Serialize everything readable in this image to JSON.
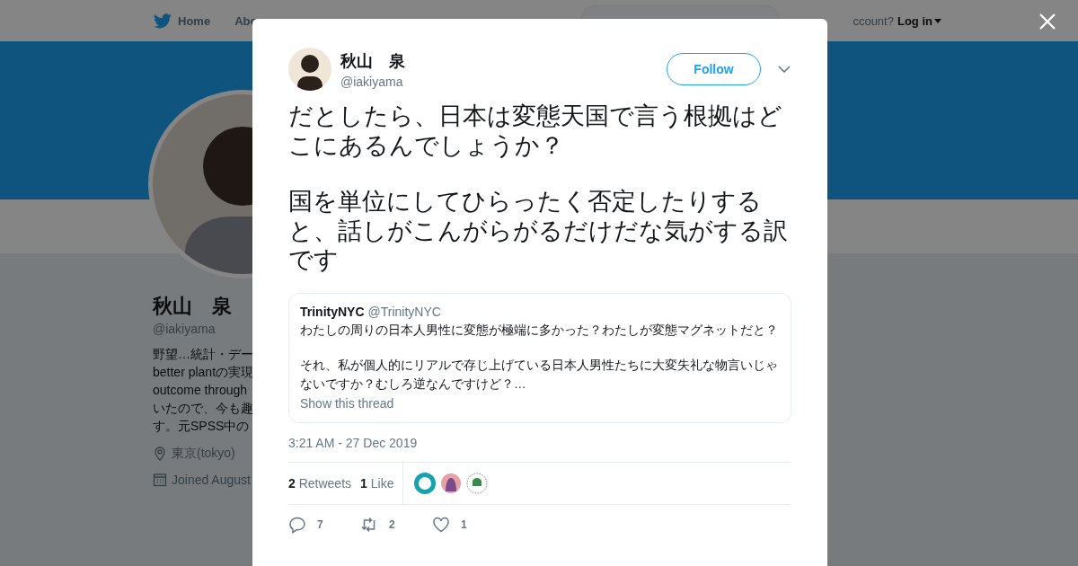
{
  "topbar": {
    "home": "Home",
    "about": "Abo",
    "account": "ccount?",
    "login": "Log in"
  },
  "profile": {
    "name": "秋山　泉",
    "handle": "@iakiyama",
    "bio_lines": [
      "野望…統計・デー",
      "better plantの実現",
      "outcome through",
      "いたので、今も趣",
      "す。元SPSS中の"
    ],
    "location": "東京(tokyo)",
    "joined": "Joined August"
  },
  "tweet": {
    "author": "秋山　泉",
    "handle": "@iakiyama",
    "follow": "Follow",
    "paragraphs": [
      "だとしたら、日本は変態天国で言う根拠はどこにあるんでしょうか？",
      "国を単位にしてひらったく否定したりすると、話しがこんがらがるだけだな気がする訳です"
    ],
    "quote": {
      "author": "TrinityNYC",
      "handle": "@TrinityNYC",
      "paragraphs": [
        "わたしの周りの日本人男性に変態が極端に多かった？わたしが変態マグネットだと？",
        "それ、私が個人的にリアルで存じ上げている日本人男性たちに大変失礼な物言いじゃないですか？むしろ逆なんですけど？…"
      ],
      "link": "Show this thread"
    },
    "timestamp": "3:21 AM - 27 Dec 2019",
    "stats": [
      {
        "count": "2",
        "label": "Retweets"
      },
      {
        "count": "1",
        "label": "Like"
      }
    ],
    "likers": [
      {
        "color": "#17a2b0"
      },
      {
        "color": "#e8a0a8"
      },
      {
        "color": "#3a8a4a"
      }
    ],
    "actions": [
      {
        "kind": "reply",
        "count": "7"
      },
      {
        "kind": "retweet",
        "count": "2"
      },
      {
        "kind": "like",
        "count": "1"
      }
    ]
  }
}
